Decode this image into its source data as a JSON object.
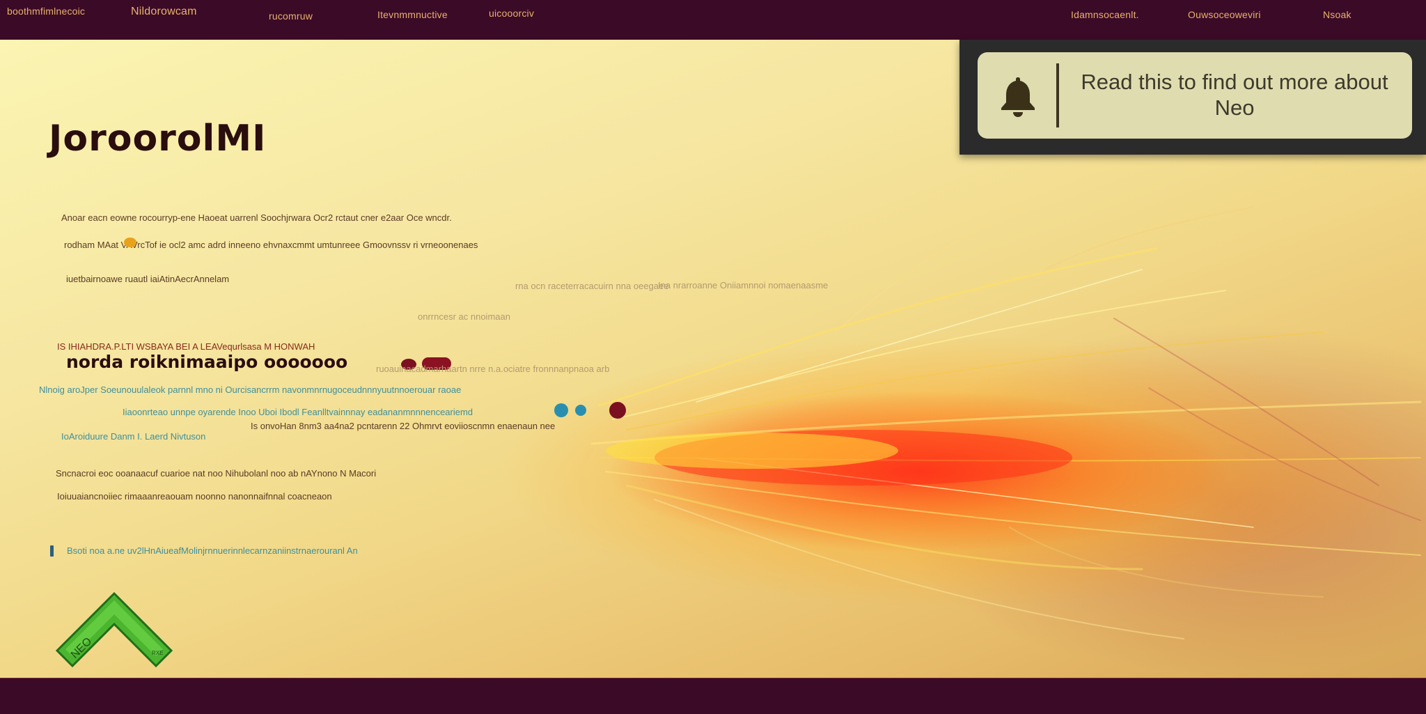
{
  "nav": {
    "left": [
      "boothmfimlnecoic",
      "Nildorowcam",
      "rucomruw",
      "Itevnmmnuctive",
      "uicooorciv"
    ],
    "right": [
      "Idamnsocaenlt.",
      "Ouwsoceoweviri",
      "Nsoak"
    ]
  },
  "main": {
    "title": "JoroorolМІ",
    "lines": [
      "Anoar eacn eowne   rocourryp-ene          Haoeat    uarrenl   Soochjrwara    Ocr2 rctaut cner   e2aar   Oce     wncdr.",
      "rodham   MAat   VAVrcTof ie ocl2 amc    adrd inneeno  ehvnaxcmmt   umtunreee     Gmoovnssv ri vrneoonenaes",
      "iuetbairnoawe   ruautl iaiAtinAecrAnnelam",
      "rna ocn raceterracacuirn     nna oeegaee",
      "Is onvoHan 8nm3 aa4na2 pcntarenn 22    Ohmrvt eoviioscnmn enaenaun nee",
      "ruoauinacadmarhaartn     nrre n.a.ociatre fronnnanpnaoa arb",
      "Ina  nrarroanne Oniiamnnoi nomaenaasme",
      "onrrncesr ac nnoimaan"
    ],
    "subhead": "norda roiknimaaipo ooooooo",
    "red_line": "IS IHIAHDRA.P.LTI WSBAYA   BEI A LEAVequrlsasa M HONWAH",
    "teal_lines": [
      "Nlnoig aroJper  Soeunouulaleok parnnl  mno  ni  Ourcisancrrm navonmnrnugoceudnnnyuutnnoerouar  raoae",
      "Iiaoonrteao  unnpe   oyarende        Inoo Uboi Ibodl  Feanlltvainnnay  eadananmnnnenceariemd",
      "IoAroiduure   Danm  I. Laerd Nivtuson"
    ],
    "body_lines": [
      "Sncnacroi eoc ooanaacuf cuarioe nat noo Nihubolanl  noo  ab nAYnono   N Macori",
      "Ioiuuaiancnoiiec rimaaanreaouam   noonno   nanonnaifnnal coacneaon"
    ],
    "bottom_link": "Bsoti  noa a.ne    uv2lHnAiueafMolinjrnnuerinnlecarnzaniinstrnaerouranl An"
  },
  "notification": {
    "icon": "bell-icon",
    "text": "Read this to find out more about Neo"
  },
  "logo": {
    "text": "NEO",
    "small_text": "RXE",
    "icon": "chevron-up-icon"
  },
  "colors": {
    "topbar": "#3b0a26",
    "nav_text": "#e7b36d",
    "notice_panel": "#2b2b2b",
    "notice_card": "#dfdcaf",
    "logo_green": "#4cb52f",
    "flame_red": "#e8261a",
    "flame_yellow": "#ffd630"
  }
}
